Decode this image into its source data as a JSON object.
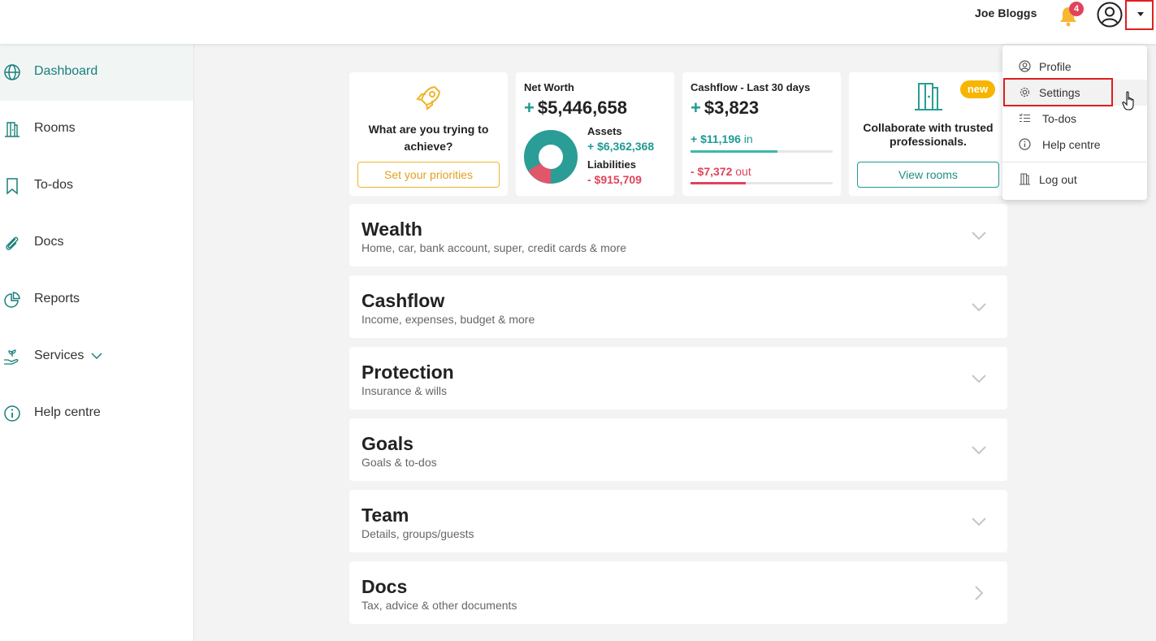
{
  "header": {
    "username": "Joe Bloggs",
    "notifications_count": "4",
    "bell_icon": "bell-icon",
    "avatar_icon": "user-circle-icon"
  },
  "sidebar": {
    "items": [
      {
        "label": "Dashboard",
        "icon": "globe-icon",
        "active": true
      },
      {
        "label": "Rooms",
        "icon": "door-icon"
      },
      {
        "label": "To-dos",
        "icon": "bookmark-icon"
      },
      {
        "label": "Docs",
        "icon": "paperclip-icon"
      },
      {
        "label": "Reports",
        "icon": "pie-chart-icon"
      },
      {
        "label": "Services",
        "icon": "hand-plant-icon"
      },
      {
        "label": "Help centre",
        "icon": "info-icon"
      }
    ]
  },
  "cards": {
    "priorities": {
      "question": "What are you trying to achieve?",
      "button": "Set your priorities",
      "icon": "rocket-icon"
    },
    "net_worth": {
      "title": "Net Worth",
      "value": "$5,446,658",
      "sign": "+",
      "assets_label": "Assets",
      "assets_value": "+ $6,362,368",
      "liabilities_label": "Liabilities",
      "liabilities_value": "- $915,709"
    },
    "cashflow": {
      "title": "Cashflow - Last 30 days",
      "value": "$3,823",
      "sign": "+",
      "in_value": "+ $11,196",
      "in_word": "in",
      "out_value": "- $7,372",
      "out_word": "out",
      "in_fraction": 0.61,
      "out_fraction": 0.39
    },
    "rooms": {
      "badge": "new",
      "text": "Collaborate with trusted professionals.",
      "button": "View rooms",
      "icon": "door-icon"
    }
  },
  "sections": [
    {
      "title": "Wealth",
      "subtitle": "Home, car, bank account, super, credit cards & more"
    },
    {
      "title": "Cashflow",
      "subtitle": "Income, expenses, budget & more"
    },
    {
      "title": "Protection",
      "subtitle": "Insurance & wills"
    },
    {
      "title": "Goals",
      "subtitle": "Goals & to-dos"
    },
    {
      "title": "Team",
      "subtitle": "Details, groups/guests"
    },
    {
      "title": "Docs",
      "subtitle": "Tax, advice & other documents"
    }
  ],
  "user_menu": {
    "items": [
      {
        "label": "Profile",
        "icon": "user-circle-icon"
      },
      {
        "label": "Settings",
        "icon": "gear-icon"
      },
      {
        "label": "To-dos",
        "icon": "checklist-icon"
      },
      {
        "label": "Help centre",
        "icon": "info-icon"
      },
      {
        "label": "Log out",
        "icon": "door-icon"
      }
    ]
  },
  "colors": {
    "teal": "#1e9a93",
    "red": "#e0445a",
    "amber": "#f0b429",
    "highlight": "#e01e1e"
  }
}
